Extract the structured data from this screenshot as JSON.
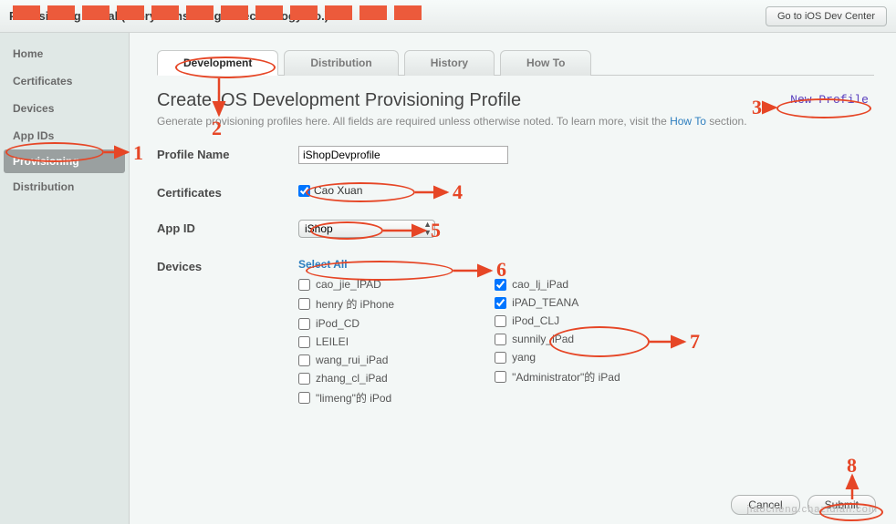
{
  "topbar": {
    "title": "Provisioning Portal (Glory Consulting & Technology Co.)",
    "devcenter_label": "Go to iOS Dev Center"
  },
  "sidebar": {
    "items": [
      {
        "label": "Home"
      },
      {
        "label": "Certificates"
      },
      {
        "label": "Devices"
      },
      {
        "label": "App IDs"
      },
      {
        "label": "Provisioning",
        "active": true
      },
      {
        "label": "Distribution"
      }
    ]
  },
  "tabs": [
    {
      "label": "Development",
      "active": true
    },
    {
      "label": "Distribution"
    },
    {
      "label": "History"
    },
    {
      "label": "How To"
    }
  ],
  "page": {
    "title": "Create iOS Development Provisioning Profile",
    "subtext_pre": "Generate provisioning profiles here. All fields are required unless otherwise noted. To learn more, visit the ",
    "subtext_link": "How To",
    "subtext_post": " section.",
    "new_profile": "New Profile"
  },
  "form": {
    "profile_name_label": "Profile Name",
    "profile_name_value": "iShopDevprofile",
    "certificates_label": "Certificates",
    "cert_name": "Cao Xuan",
    "appid_label": "App ID",
    "appid_value": "iShop",
    "devices_label": "Devices",
    "select_all": "Select All",
    "devices_col1": [
      {
        "label": "cao_jie_IPAD",
        "checked": false
      },
      {
        "label": "henry 的 iPhone",
        "checked": false
      },
      {
        "label": "iPod_CD",
        "checked": false
      },
      {
        "label": "LEILEI",
        "checked": false
      },
      {
        "label": "wang_rui_iPad",
        "checked": false
      },
      {
        "label": "zhang_cl_iPad",
        "checked": false
      },
      {
        "label": "\"limeng\"的 iPod",
        "checked": false
      }
    ],
    "devices_col2": [
      {
        "label": "cao_lj_iPad",
        "checked": true
      },
      {
        "label": "iPAD_TEANA",
        "checked": true
      },
      {
        "label": "iPod_CLJ",
        "checked": false
      },
      {
        "label": "sunnily_iPad",
        "checked": false
      },
      {
        "label": "yang",
        "checked": false
      },
      {
        "label": "\"Administrator\"的 iPad",
        "checked": false
      }
    ]
  },
  "footer": {
    "cancel": "Cancel",
    "submit": "Submit"
  },
  "annotations": [
    "1",
    "2",
    "3",
    "4",
    "5",
    "6",
    "7",
    "8"
  ],
  "watermark": "jiaocheng.chazidian.com"
}
